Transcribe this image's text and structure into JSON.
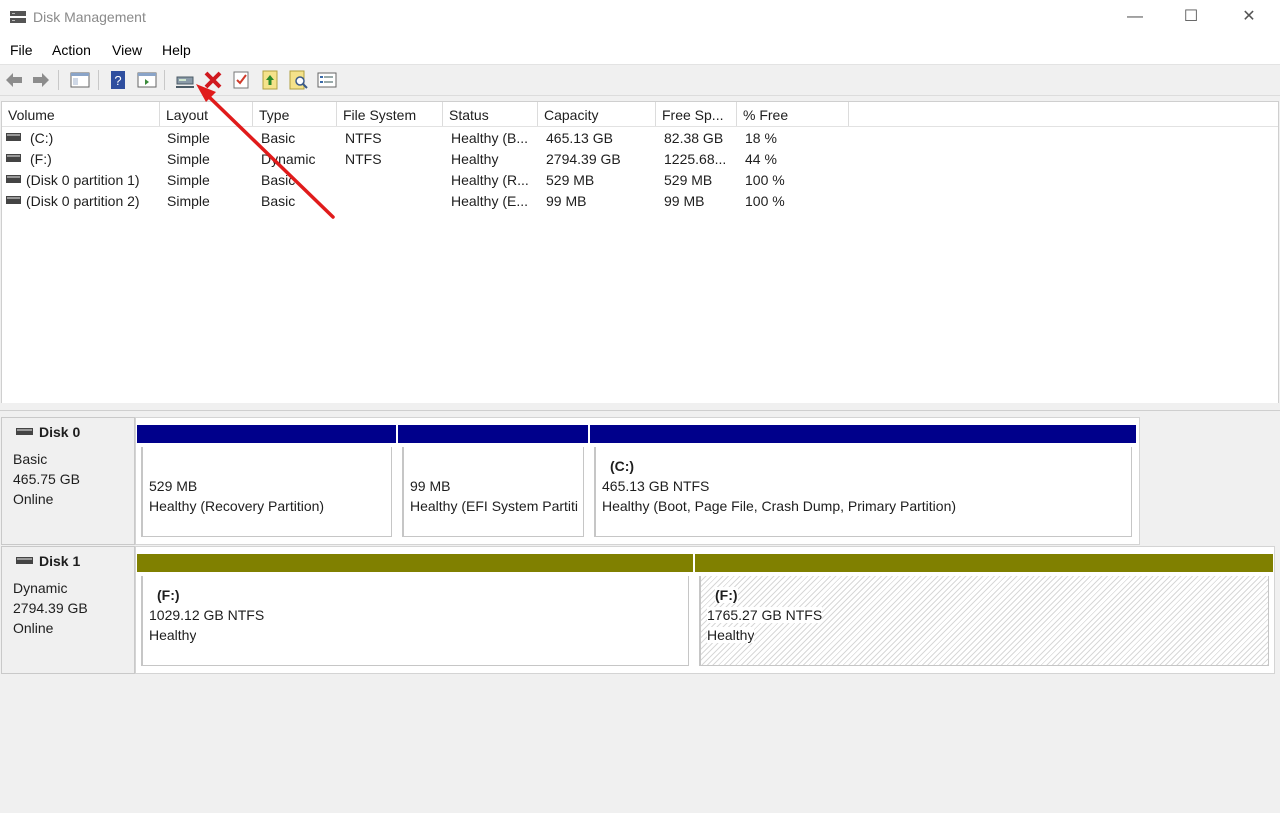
{
  "window": {
    "title": "Disk Management",
    "min_glyph": "—",
    "max_glyph": "☐",
    "close_glyph": "✕"
  },
  "menu": [
    "File",
    "Action",
    "View",
    "Help"
  ],
  "toolbar_icons": [
    "back-icon",
    "forward-icon",
    "show-hide-console-tree-icon",
    "help-icon",
    "properties-icon",
    "connect-drive-icon",
    "delete-icon",
    "check-icon",
    "export-icon",
    "search-icon",
    "list-icon"
  ],
  "columns": [
    "Volume",
    "Layout",
    "Type",
    "File System",
    "Status",
    "Capacity",
    "Free Sp...",
    "% Free"
  ],
  "volumes": [
    {
      "volume": "(C:)",
      "layout": "Simple",
      "type": "Basic",
      "fs": "NTFS",
      "status": "Healthy (B...",
      "capacity": "465.13 GB",
      "free": "82.38 GB",
      "pct": "18 %"
    },
    {
      "volume": "(F:)",
      "layout": "Simple",
      "type": "Dynamic",
      "fs": "NTFS",
      "status": "Healthy",
      "capacity": "2794.39 GB",
      "free": "1225.68...",
      "pct": "44 %"
    },
    {
      "volume": "(Disk 0 partition 1)",
      "layout": "Simple",
      "type": "Basic",
      "fs": "",
      "status": "Healthy (R...",
      "capacity": "529 MB",
      "free": "529 MB",
      "pct": "100 %"
    },
    {
      "volume": "(Disk 0 partition 2)",
      "layout": "Simple",
      "type": "Basic",
      "fs": "",
      "status": "Healthy (E...",
      "capacity": "99 MB",
      "free": "99 MB",
      "pct": "100 %"
    }
  ],
  "disks": [
    {
      "name": "Disk 0",
      "kind": "Basic",
      "size": "465.75 GB",
      "state": "Online",
      "partitions": [
        {
          "title": "",
          "size": "529 MB",
          "status": "Healthy (Recovery Partition)"
        },
        {
          "title": "",
          "size": "99 MB",
          "status": "Healthy (EFI System Partiti"
        },
        {
          "title": "(C:)",
          "size": "465.13 GB NTFS",
          "status": "Healthy (Boot, Page File, Crash Dump, Primary Partition)"
        }
      ]
    },
    {
      "name": "Disk 1",
      "kind": "Dynamic",
      "size": "2794.39 GB",
      "state": "Online",
      "partitions": [
        {
          "title": "(F:)",
          "size": "1029.12 GB NTFS",
          "status": "Healthy"
        },
        {
          "title": "(F:)",
          "size": "1765.27 GB NTFS",
          "status": "Healthy"
        }
      ]
    }
  ],
  "colors": {
    "basic_bar": "#00008b",
    "dynamic_bar": "#808000",
    "annotation_arrow": "#e01b1b"
  }
}
